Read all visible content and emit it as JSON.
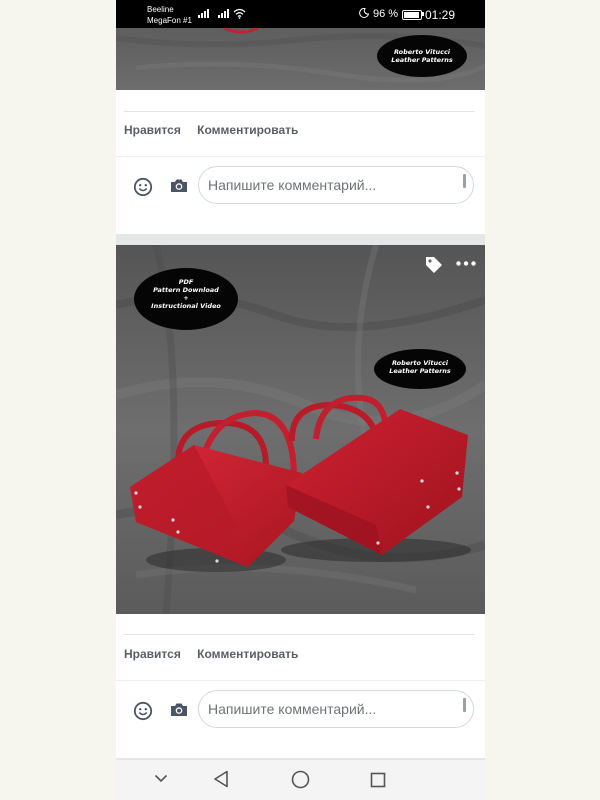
{
  "status_bar": {
    "carrier_1": "Beeline",
    "carrier_2": "MegaFon #1",
    "battery_text": "96 %",
    "battery_level": 0.96,
    "time": "01:29"
  },
  "post_1": {
    "image_caption_brand_1": "Roberto Vitucci",
    "image_caption_brand_2": "Leather Patterns",
    "like_label": "Нравится",
    "comment_label": "Комментировать",
    "comment_placeholder": "Напишите комментарий..."
  },
  "post_2": {
    "image_caption_pdf_1": "PDF",
    "image_caption_pdf_2": "Pattern Download",
    "image_caption_pdf_3": "+",
    "image_caption_pdf_4": "Instructional Video",
    "image_caption_brand_1": "Roberto Vitucci",
    "image_caption_brand_2": "Leather Patterns",
    "like_label": "Нравится",
    "comment_label": "Комментировать",
    "comment_placeholder": "Напишите комментарий..."
  },
  "icons": {
    "emoji": "smile-icon",
    "camera": "camera-icon",
    "tag": "tag-icon",
    "more": "more-icon",
    "nav_down": "chevron-down-icon",
    "nav_back": "back-triangle-icon",
    "nav_home": "home-circle-icon",
    "nav_recents": "recents-square-icon"
  },
  "colors": {
    "action_text": "#5a5f66",
    "bag_red": "#c8202f",
    "icon_gray": "#4a5565"
  }
}
